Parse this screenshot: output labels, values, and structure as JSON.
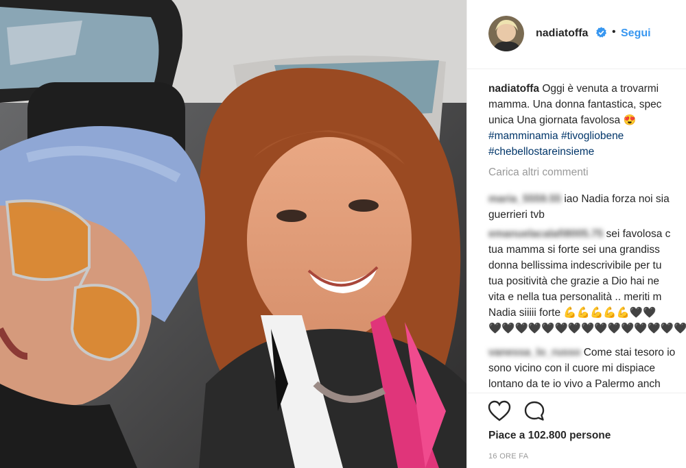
{
  "post": {
    "username": "nadiatoffa",
    "follow_label": "Segui",
    "separator": "•",
    "caption": {
      "line1": "Oggi è venuta a trovarmi",
      "line2": "mamma. Una donna fantastica, spec",
      "line3": "unica Una giornata favolosa",
      "line3_emoji": "😍",
      "hashtags": [
        "#mamminamia",
        "#tivogliobene",
        "#chebellostareinsieme"
      ]
    },
    "load_more": "Carica altri commenti",
    "comments": [
      {
        "user": "maria_5559.55",
        "lines": [
          "iao Nadia forza noi sia",
          "guerrieri tvb"
        ]
      },
      {
        "user": "emanuelacalafi8005.75",
        "lines": [
          "sei favolosa c",
          "tua mamma si forte sei una grandiss",
          "donna bellissima indescrivibile per tu",
          "tua positività che grazie a Dio hai ne",
          "vita e nella tua personalità .. meriti m",
          "Nadia siiiii forte 💪💪💪💪💪🖤🖤",
          "🖤🖤🖤🖤🖤🖤🖤🖤🖤🖤🖤🖤🖤🖤🖤🖤"
        ]
      },
      {
        "user": "vanessa_lo_russo",
        "lines": [
          "Come stai tesoro io",
          "sono vicino con il cuore mi dispiace",
          "lontano da te io vivo a Palermo anch"
        ]
      }
    ],
    "likes": "Piace a 102.800 persone",
    "time": "16 ORE FA"
  },
  "icons": {
    "verified": "verified-badge-icon",
    "like": "heart-icon",
    "comment": "comment-bubble-icon"
  },
  "colors": {
    "link": "#3897f0",
    "hashtag": "#003569",
    "muted": "#999999",
    "text": "#262626"
  }
}
